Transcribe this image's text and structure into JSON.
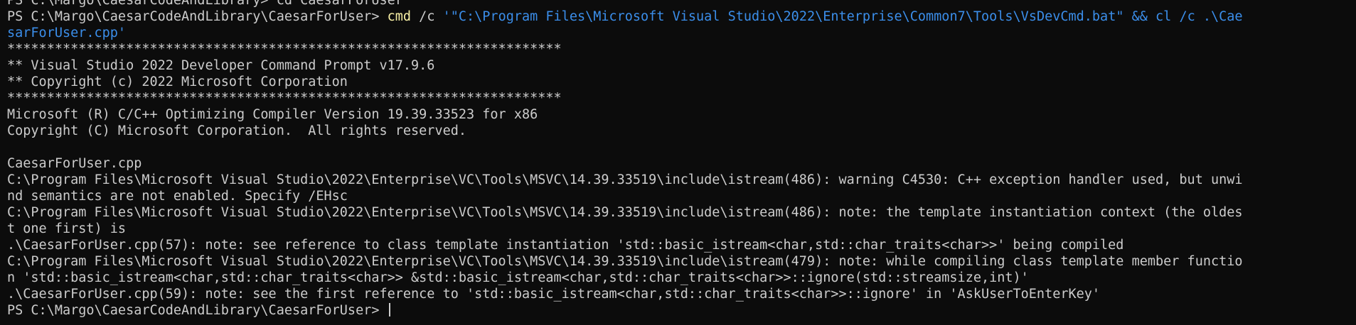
{
  "terminal": {
    "lines": {
      "l0": "PS C:\\Margo\\CaesarCodeAndLibrary> cd CaesarForUser",
      "l1_prompt": "PS C:\\Margo\\CaesarCodeAndLibrary\\CaesarForUser> ",
      "l1_cmd": "cmd",
      "l1_flag": " /c ",
      "l1_arg": "'\"C:\\Program Files\\Microsoft Visual Studio\\2022\\Enterprise\\Common7\\Tools\\VsDevCmd.bat\" && cl /c .\\Cae",
      "l2_arg": "sarForUser.cpp'",
      "l3": "**********************************************************************",
      "l4": "** Visual Studio 2022 Developer Command Prompt v17.9.6",
      "l5": "** Copyright (c) 2022 Microsoft Corporation",
      "l6": "**********************************************************************",
      "l7": "Microsoft (R) C/C++ Optimizing Compiler Version 19.39.33523 for x86",
      "l8": "Copyright (C) Microsoft Corporation.  All rights reserved.",
      "l10": "CaesarForUser.cpp",
      "l11": "C:\\Program Files\\Microsoft Visual Studio\\2022\\Enterprise\\VC\\Tools\\MSVC\\14.39.33519\\include\\istream(486): warning C4530: C++ exception handler used, but unwi",
      "l12": "nd semantics are not enabled. Specify /EHsc",
      "l13": "C:\\Program Files\\Microsoft Visual Studio\\2022\\Enterprise\\VC\\Tools\\MSVC\\14.39.33519\\include\\istream(486): note: the template instantiation context (the oldes",
      "l14": "t one first) is",
      "l15": ".\\CaesarForUser.cpp(57): note: see reference to class template instantiation 'std::basic_istream<char,std::char_traits<char>>' being compiled",
      "l16": "C:\\Program Files\\Microsoft Visual Studio\\2022\\Enterprise\\VC\\Tools\\MSVC\\14.39.33519\\include\\istream(479): note: while compiling class template member functio",
      "l17": "n 'std::basic_istream<char,std::char_traits<char>> &std::basic_istream<char,std::char_traits<char>>::ignore(std::streamsize,int)'",
      "l18": ".\\CaesarForUser.cpp(59): note: see the first reference to 'std::basic_istream<char,std::char_traits<char>>::ignore' in 'AskUserToEnterKey'",
      "l19_prompt": "PS C:\\Margo\\CaesarCodeAndLibrary\\CaesarForUser> "
    },
    "colors": {
      "background": "#0c0c0c",
      "text": "#cccccc",
      "command": "#f9f1a5",
      "string": "#3b8eea"
    }
  }
}
